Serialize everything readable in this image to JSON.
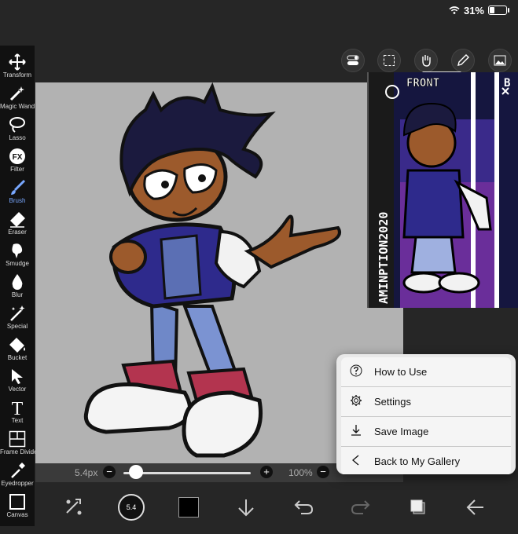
{
  "status": {
    "battery": "31%",
    "battery_level": 0.31
  },
  "tools": [
    {
      "label": "Transform",
      "icon": "move-arrows-icon"
    },
    {
      "label": "Magic Wand",
      "icon": "magic-wand-icon"
    },
    {
      "label": "Lasso",
      "icon": "lasso-icon"
    },
    {
      "label": "Filter",
      "icon": "fx-icon"
    },
    {
      "label": "Brush",
      "icon": "brush-icon"
    },
    {
      "label": "Eraser",
      "icon": "eraser-icon"
    },
    {
      "label": "Smudge",
      "icon": "smudge-icon"
    },
    {
      "label": "Blur",
      "icon": "drop-icon"
    },
    {
      "label": "Special",
      "icon": "sparkle-wand-icon"
    },
    {
      "label": "Bucket",
      "icon": "bucket-icon"
    },
    {
      "label": "Vector",
      "icon": "cursor-arrow-icon"
    },
    {
      "label": "Text",
      "icon": "text-icon"
    },
    {
      "label": "Frame Divider",
      "icon": "frame-divider-icon"
    },
    {
      "label": "Eyedropper",
      "icon": "eyedropper-icon"
    },
    {
      "label": "Canvas",
      "icon": "canvas-icon"
    }
  ],
  "active_tool": "Brush",
  "fx_text": "FX",
  "text_tool_glyph": "T",
  "brush_size": {
    "label": "5.4px",
    "level": 0.1
  },
  "opacity": {
    "label": "100%"
  },
  "color_size": "5.4",
  "reference": {
    "front_label": "FRONT",
    "back_label": "B",
    "side_text": "AMINPTION2020"
  },
  "menu": {
    "items": [
      {
        "label": "How to Use",
        "icon": "question-circle-icon"
      },
      {
        "label": "Settings",
        "icon": "gear-icon"
      },
      {
        "label": "Save Image",
        "icon": "download-icon"
      },
      {
        "label": "Back to My Gallery",
        "icon": "chevron-left-icon"
      }
    ]
  },
  "colors": {
    "accent": "#79a8ff",
    "canvas_bg": "#b2b2b2",
    "primary_color": "#000000"
  },
  "plus": "+",
  "minus": "−"
}
